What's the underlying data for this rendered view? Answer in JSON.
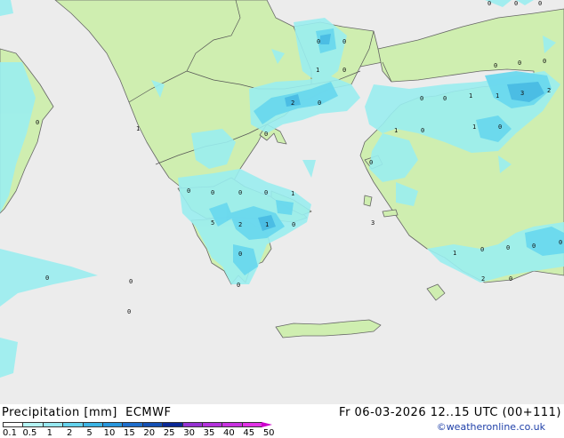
{
  "map": {
    "sea_color": "#ececec",
    "land_color": "#cfeeb0",
    "precip_levels": [
      "#9aeef0",
      "#6ad8ee",
      "#4bbde4"
    ],
    "point_labels": [
      "0",
      "0",
      "0",
      "0",
      "0",
      "0",
      "1",
      "0",
      "0",
      "0",
      "0",
      "1",
      "1",
      "3",
      "2",
      "2",
      "0",
      "0",
      "1",
      "0",
      "1",
      "0",
      "0",
      "1",
      "0",
      "0",
      "0",
      "0",
      "0",
      "0",
      "1",
      "3",
      "5",
      "2",
      "1",
      "0",
      "0",
      "1",
      "0",
      "0",
      "0",
      "0",
      "0",
      "2",
      "0",
      "0",
      "0",
      "0"
    ]
  },
  "footer": {
    "title": "Precipitation [mm]  ECMWF",
    "time": "Fr 06-03-2026 12..15 UTC (00+111)",
    "credit": "©weatheronline.co.uk",
    "colorbar": {
      "ticks": [
        "0.1",
        "0.5",
        "1",
        "2",
        "5",
        "10",
        "15",
        "20",
        "25",
        "30",
        "35",
        "40",
        "45",
        "50"
      ],
      "colors": [
        "#ffffff",
        "#b4f4f4",
        "#96e8f0",
        "#64d2ec",
        "#3cb4e4",
        "#2896dc",
        "#1e6ecc",
        "#1450b4",
        "#0a2896",
        "#9632d2",
        "#b432dc",
        "#c832e0",
        "#e132e6"
      ],
      "arrow_color": "#cc00cc"
    }
  }
}
